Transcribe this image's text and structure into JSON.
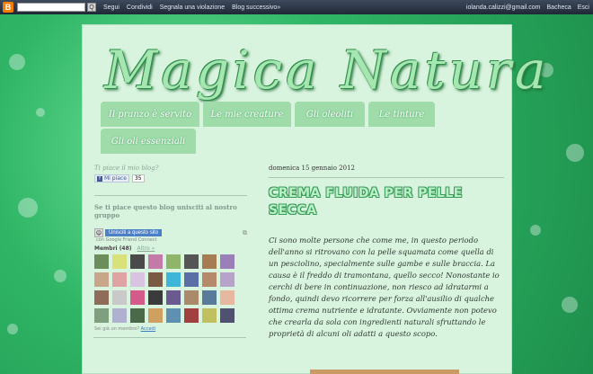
{
  "navbar": {
    "logo_letter": "B",
    "search_button": "Q",
    "links": [
      "Segui",
      "Condividi",
      "Segnala una violazione",
      "Blog successivo»"
    ],
    "user_email": "iolanda.calizzi@gmail.com",
    "dashboard": "Bacheca",
    "logout": "Esci"
  },
  "blog": {
    "title": "Magica Natura",
    "tabs": [
      "Il pranzo è servito",
      "Le mie creature",
      "Gli oleoliti",
      "Le tinture",
      "Gli oli essenziali"
    ]
  },
  "sidebar": {
    "like_label": "Ti piace il mio blog?",
    "fb_button": "Mi piace",
    "fb_count": "35",
    "join_title": "Se ti piace questo blog unisciti al nostro gruppo",
    "gfc_join": "Unisciti a questo sito",
    "gfc_sub": "con Google Friend Connect",
    "members_label": "Membri (48)",
    "members_more": "Altro »",
    "gfc_foot_prefix": "Sei già un membro?",
    "gfc_foot_link": "Accedi"
  },
  "post": {
    "date": "domenica 15 gennaio 2012",
    "title": "CREMA FLUIDA PER PELLE SECCA",
    "body": "Ci sono molte persone che come me, in questo periodo dell'anno si ritrovano con la pelle squamata come quella di un pesciolino, specialmente sulle gambe e sulle braccia. La causa è il freddo di tramontana, quello secco! Nonostante io cerchi di bere in continuazione, non riesco ad idratarmi a fondo, quindi devo ricorrere per forza all'ausilio di qualche ottima crema nutriente e idratante. Ovviamente non potevo che crearla da sola con ingredienti naturali sfruttando le proprietà di alcuni oli adatti a questo scopo."
  },
  "colors": {
    "background": "#2fb565",
    "container": "#d8f3de",
    "tab": "#9fdcaa",
    "title_outline": "#3a9a5a"
  }
}
